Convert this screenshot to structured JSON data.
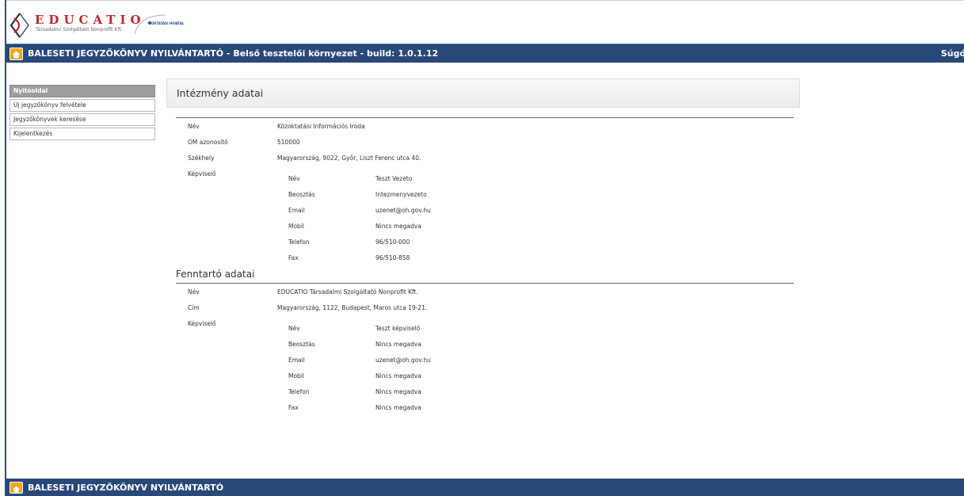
{
  "brand": {
    "name": "EDUCATIO",
    "subtitle": "Társadalmi Szolgáltató Nonprofit Kft.",
    "partner": "OKTATÁSI HIVATAL"
  },
  "topbar": {
    "title": "BALESETI JEGYZŐKÖNYV NYILVÁNTARTÓ - Belső tesztelői környezet - build: 1.0.1.12",
    "help": "Súgó",
    "home_icon": "home-icon"
  },
  "sidebar": {
    "items": [
      {
        "label": "Nyitóoldal",
        "active": true
      },
      {
        "label": "Új jegyzőkönyv felvétele",
        "active": false
      },
      {
        "label": "Jegyzőkönyvek keresése",
        "active": false
      },
      {
        "label": "Kijelentkezés",
        "active": false
      }
    ]
  },
  "institution": {
    "title": "Intézmény adatai",
    "rows": [
      {
        "label": "Név",
        "value": "Közoktatási Információs Iroda"
      },
      {
        "label": "OM azonosító",
        "value": "510000"
      },
      {
        "label": "Székhely",
        "value": "Magyarország, 9022, Győr, Liszt Ferenc utca 40."
      }
    ],
    "rep_label": "Képviselő",
    "rep": [
      {
        "label": "Név",
        "value": "Teszt Vezeto"
      },
      {
        "label": "Beosztás",
        "value": "Intezmenyvezeto"
      },
      {
        "label": "Email",
        "value": "uzenet@oh.gov.hu"
      },
      {
        "label": "Mobil",
        "value": "Nincs megadva"
      },
      {
        "label": "Telefon",
        "value": "96/510-000"
      },
      {
        "label": "Fax",
        "value": "96/510-858"
      }
    ]
  },
  "maintainer": {
    "title": "Fenntartó adatai",
    "rows": [
      {
        "label": "Név",
        "value": "EDUCATIO Társadalmi Szolgáltató Nonprofit Kft."
      },
      {
        "label": "Cím",
        "value": "Magyarország, 1122, Budapest, Maros utca 19-21."
      }
    ],
    "rep_label": "Képviselő",
    "rep": [
      {
        "label": "Név",
        "value": "Teszt képviselő"
      },
      {
        "label": "Beosztás",
        "value": "Nincs megadva"
      },
      {
        "label": "Email",
        "value": "uzenet@oh.gov.hu"
      },
      {
        "label": "Mobil",
        "value": "Nincs megadva"
      },
      {
        "label": "Telefon",
        "value": "Nincs megadva"
      },
      {
        "label": "Fax",
        "value": "Nincs megadva"
      }
    ]
  },
  "footer": {
    "title": "BALESETI JEGYZŐKÖNYV NYILVÁNTARTÓ"
  },
  "colors": {
    "bar": "#274879",
    "home": "#f4a51c",
    "brand_red": "#c0262d"
  }
}
